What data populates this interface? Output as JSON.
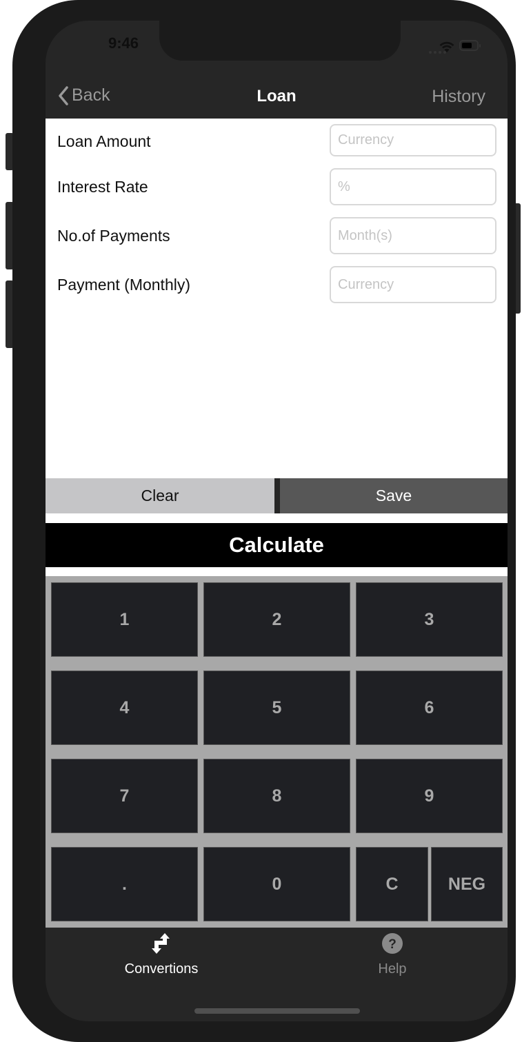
{
  "status_bar": {
    "time": "9:46"
  },
  "nav": {
    "back_label": "Back",
    "title": "Loan",
    "history_label": "History"
  },
  "form": {
    "fields": [
      {
        "label": "Loan Amount",
        "value": "",
        "placeholder": "Currency"
      },
      {
        "label": "Interest Rate",
        "value": "",
        "placeholder": "%"
      },
      {
        "label": "No.of Payments",
        "value": "",
        "placeholder": "Month(s)"
      },
      {
        "label": "Payment (Monthly)",
        "value": "",
        "placeholder": "Currency"
      }
    ]
  },
  "actions": {
    "clear_label": "Clear",
    "save_label": "Save",
    "calculate_label": "Calculate"
  },
  "keypad": {
    "keys": [
      "1",
      "2",
      "3",
      "4",
      "5",
      "6",
      "7",
      "8",
      "9",
      ".",
      "0",
      "C",
      "NEG"
    ]
  },
  "tabbar": {
    "items": [
      {
        "label": "Convertions",
        "icon": "conversion-arrows-icon",
        "active": true
      },
      {
        "label": "Help",
        "icon": "help-circle-icon",
        "active": false
      }
    ]
  },
  "colors": {
    "nav_bg": "#262626",
    "clear_bg": "#c5c5c7",
    "save_bg": "#575757",
    "calculate_bg": "#000000",
    "keypad_bg": "#a8a8a8",
    "key_bg": "#1f2024",
    "key_text": "#a9a9a9"
  }
}
